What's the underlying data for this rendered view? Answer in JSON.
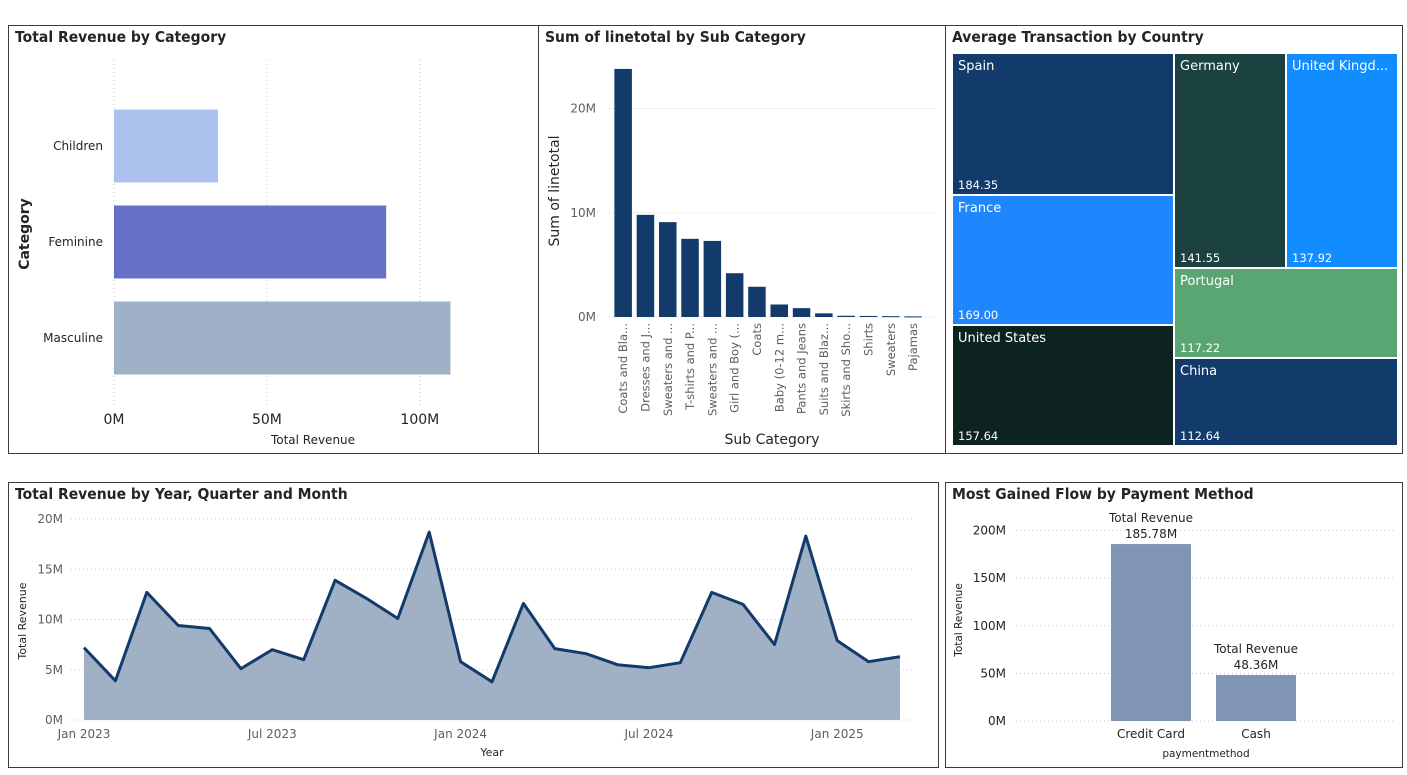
{
  "panels": {
    "category": "Total Revenue by Category",
    "subcategory": "Sum of linetotal by Sub Category",
    "country": "Average Transaction by Country",
    "timeline": "Total Revenue by Year, Quarter and Month",
    "payment": "Most Gained Flow by Payment Method"
  },
  "colors": {
    "navy": "#123b6b",
    "area_fill": "#a0b1c6",
    "payment_bar": "#8094b4"
  },
  "chart_data": [
    {
      "id": "category",
      "type": "bar",
      "orientation": "horizontal",
      "title": "Total Revenue by Category",
      "xlabel": "Total Revenue",
      "ylabel": "Category",
      "categories": [
        "Children",
        "Feminine",
        "Masculine"
      ],
      "values": [
        34,
        89,
        110
      ],
      "colors": [
        "#adc1ef",
        "#6670c6",
        "#9eb1c6"
      ],
      "xlim": [
        0,
        120
      ],
      "xticks": [
        {
          "v": 0,
          "label": "0M"
        },
        {
          "v": 50,
          "label": "50M"
        },
        {
          "v": 100,
          "label": "100M"
        }
      ],
      "grid": true
    },
    {
      "id": "subcategory",
      "type": "bar",
      "title": "Sum of linetotal by Sub Category",
      "xlabel": "Sub Category",
      "ylabel": "Sum of linetotal",
      "categories": [
        "Coats and Bla...",
        "Dresses and J...",
        "Sweaters and ...",
        "T-shirts and P...",
        "Sweaters and ...",
        "Girl and Boy (...",
        "Coats",
        "Baby (0-12 m...",
        "Pants and Jeans",
        "Suits and Blaz...",
        "Skirts and Sho...",
        "Shirts",
        "Sweaters",
        "Pajamas"
      ],
      "values": [
        23.8,
        9.8,
        9.1,
        7.5,
        7.3,
        4.2,
        2.9,
        1.2,
        0.85,
        0.35,
        0.12,
        0.1,
        0.08,
        0.06
      ],
      "ylim": [
        0,
        26
      ],
      "yticks": [
        {
          "v": 0,
          "label": "0M"
        },
        {
          "v": 10,
          "label": "10M"
        },
        {
          "v": 20,
          "label": "20M"
        }
      ],
      "grid": true
    },
    {
      "id": "country",
      "type": "treemap",
      "title": "Average Transaction by Country",
      "items": [
        {
          "name": "Spain",
          "value": "184.35",
          "color": "#123b6b"
        },
        {
          "name": "Germany",
          "value": "141.55",
          "color": "#1b4240"
        },
        {
          "name": "United Kingd...",
          "value": "137.92",
          "color": "#118dff"
        },
        {
          "name": "France",
          "value": "169.00",
          "color": "#1f87fd"
        },
        {
          "name": "Portugal",
          "value": "117.22",
          "color": "#5aa673"
        },
        {
          "name": "United States",
          "value": "157.64",
          "color": "#0c2320"
        },
        {
          "name": "China",
          "value": "112.64",
          "color": "#123b6b"
        }
      ]
    },
    {
      "id": "timeline",
      "type": "area",
      "title": "Total Revenue by Year, Quarter and Month",
      "xlabel": "Year",
      "ylabel": "Total Revenue",
      "x": [
        "2023-01",
        "2023-02",
        "2023-03",
        "2023-04",
        "2023-05",
        "2023-06",
        "2023-07",
        "2023-08",
        "2023-09",
        "2023-10",
        "2023-11",
        "2023-12",
        "2024-01",
        "2024-02",
        "2024-03",
        "2024-04",
        "2024-05",
        "2024-06",
        "2024-07",
        "2024-08",
        "2024-09",
        "2024-10",
        "2024-11",
        "2024-12",
        "2025-01",
        "2025-02",
        "2025-03"
      ],
      "values": [
        7.2,
        3.9,
        12.7,
        9.4,
        9.1,
        5.1,
        7.0,
        6.0,
        13.9,
        12.1,
        10.1,
        18.7,
        5.8,
        3.8,
        11.6,
        7.1,
        6.6,
        5.5,
        5.2,
        5.7,
        12.7,
        11.5,
        7.5,
        18.3,
        7.9,
        5.8,
        6.3
      ],
      "ylim": [
        0,
        20
      ],
      "yticks": [
        {
          "v": 0,
          "label": "0M"
        },
        {
          "v": 5,
          "label": "5M"
        },
        {
          "v": 10,
          "label": "10M"
        },
        {
          "v": 15,
          "label": "15M"
        },
        {
          "v": 20,
          "label": "20M"
        }
      ],
      "xticks": [
        {
          "i": 0,
          "label": "Jan 2023"
        },
        {
          "i": 6,
          "label": "Jul 2023"
        },
        {
          "i": 12,
          "label": "Jan 2024"
        },
        {
          "i": 18,
          "label": "Jul 2024"
        },
        {
          "i": 24,
          "label": "Jan 2025"
        }
      ],
      "grid": true
    },
    {
      "id": "payment",
      "type": "bar",
      "title": "Most Gained Flow by Payment Method",
      "xlabel": "paymentmethod",
      "ylabel": "Total Revenue",
      "categories": [
        "Credit Card",
        "Cash"
      ],
      "values": [
        185.78,
        48.36
      ],
      "data_labels": [
        {
          "name": "Total Revenue",
          "value": "185.78M"
        },
        {
          "name": "Total Revenue",
          "value": "48.36M"
        }
      ],
      "ylim": [
        0,
        210
      ],
      "yticks": [
        {
          "v": 0,
          "label": "0M"
        },
        {
          "v": 50,
          "label": "50M"
        },
        {
          "v": 100,
          "label": "100M"
        },
        {
          "v": 150,
          "label": "150M"
        },
        {
          "v": 200,
          "label": "200M"
        }
      ],
      "grid": true
    }
  ]
}
